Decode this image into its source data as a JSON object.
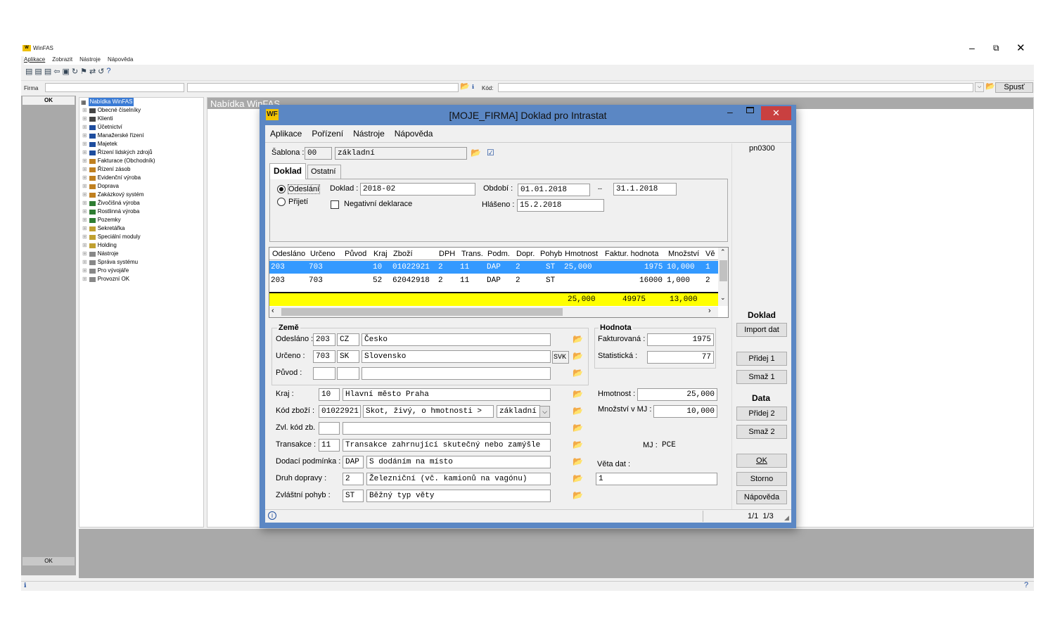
{
  "app": {
    "title": "WinFAS",
    "menu": [
      "Aplikace",
      "Zobrazit",
      "Nástroje",
      "Nápověda"
    ],
    "firma_label": "Firma",
    "kod_label": "Kód:",
    "spust_label": "Spusť",
    "left_ok": "OK",
    "left_ok_bottom": "OK",
    "panel_title": "Nabídka WinFAS",
    "tree_root": "Nabídka WinFAS",
    "tree": [
      {
        "label": "Obecné číselníky",
        "color": "#444"
      },
      {
        "label": "Klienti",
        "color": "#444"
      },
      {
        "label": "Účetnictví",
        "color": "#1e4d9e"
      },
      {
        "label": "Manažerské řízení",
        "color": "#1e4d9e"
      },
      {
        "label": "Majetek",
        "color": "#1e4d9e"
      },
      {
        "label": "Řízení lidských zdrojů",
        "color": "#1e4d9e"
      },
      {
        "label": "Fakturace (Obchodník)",
        "color": "#c08020"
      },
      {
        "label": "Řízení zásob",
        "color": "#c08020"
      },
      {
        "label": "Evidenční výroba",
        "color": "#c08020"
      },
      {
        "label": "Doprava",
        "color": "#c08020"
      },
      {
        "label": "Zakázkový systém",
        "color": "#c08020"
      },
      {
        "label": "Živočišná výroba",
        "color": "#2e7d32"
      },
      {
        "label": "Rostlinná výroba",
        "color": "#2e7d32"
      },
      {
        "label": "Pozemky",
        "color": "#2e7d32"
      },
      {
        "label": "Sekretářka",
        "color": "#c0a030"
      },
      {
        "label": "Speciální moduly",
        "color": "#c0a030"
      },
      {
        "label": "Holding",
        "color": "#c0a030"
      },
      {
        "label": "Nástroje",
        "color": "#888"
      },
      {
        "label": "Správa systému",
        "color": "#888"
      },
      {
        "label": "Pro vývojáře",
        "color": "#888"
      },
      {
        "label": "Provozní OK",
        "color": "#888"
      }
    ]
  },
  "dialog": {
    "logo": "WF",
    "title": "[MOJE_FIRMA] Doklad pro Intrastat",
    "menu": [
      "Aplikace",
      "Pořízení",
      "Nástroje",
      "Nápověda"
    ],
    "code": "pn0300",
    "sablona_label": "Šablona :",
    "sablona_code": "00",
    "sablona_name": "základní",
    "tabs": [
      "Doklad",
      "Ostatní"
    ],
    "odeslani_label": "Odeslání",
    "prijeti_label": "Přijetí",
    "doklad_label": "Doklad :",
    "doklad_value": "2018-02",
    "negativni_label": "Negativní deklarace",
    "obdobi_label": "Období :",
    "obdobi_from": "01.01.2018",
    "obdobi_dash": "--",
    "obdobi_to": "31.1.2018",
    "hlaseno_label": "Hlášeno :",
    "hlaseno_value": "15.2.2018",
    "grid_headers": [
      "Odesláno",
      "Určeno",
      "Původ",
      "Kraj",
      "Zboží",
      "DPH",
      "Trans.",
      "Podm.",
      "Dopr.",
      "Pohyb",
      "Hmotnost",
      "Faktur. hodnota",
      "Množství",
      "Vě"
    ],
    "grid_rows": [
      {
        "odeslano": "203",
        "urceno": "703",
        "puvod": "",
        "kraj": "10",
        "zbozi": "01022921",
        "dph": "2",
        "trans": "11",
        "podm": "DAP",
        "dopr": "2",
        "pohyb": "ST",
        "hmotnost": "25,000",
        "faktur": "1975",
        "mnozstvi": "10,000",
        "veta": "1"
      },
      {
        "odeslano": "203",
        "urceno": "703",
        "puvod": "",
        "kraj": "52",
        "zbozi": "62042918",
        "dph": "2",
        "trans": "11",
        "podm": "DAP",
        "dopr": "2",
        "pohyb": "ST",
        "hmotnost": "",
        "faktur": "16000",
        "mnozstvi": "1,000",
        "veta": "2"
      }
    ],
    "totals": {
      "hmotnost": "25,000",
      "faktur": "49975",
      "mnozstvi": "13,000"
    },
    "zeme_title": "Země",
    "odeslano_label": "Odesláno :",
    "odeslano_code": "203",
    "odeslano_iso": "CZ",
    "odeslano_name": "Česko",
    "urceno_label": "Určeno :",
    "urceno_code": "703",
    "urceno_iso": "SK",
    "urceno_name": "Slovensko",
    "svk_label": "SVK",
    "puvod_label": "Původ :",
    "hodnota_title": "Hodnota",
    "fakturovana_label": "Fakturovaná :",
    "fakturovana_value": "1975",
    "statisticka_label": "Statistická :",
    "statisticka_value": "77",
    "kraj_label": "Kraj :",
    "kraj_code": "10",
    "kraj_name": "Hlavní město Praha",
    "kod_zbozi_label": "Kód zboží :",
    "kod_zbozi_code": "01022921",
    "kod_zbozi_name": "Skot, živý, o hmotnosti >",
    "kod_zbozi_type": "základní",
    "zvl_kod_label": "Zvl. kód zb.",
    "transakce_label": "Transakce :",
    "transakce_code": "11",
    "transakce_name": "Transakce zahrnující skutečný nebo zamýšle",
    "dodaci_label": "Dodací podmínka :",
    "dodaci_code": "DAP",
    "dodaci_name": "S dodáním na místo",
    "druh_label": "Druh dopravy :",
    "druh_code": "2",
    "druh_name": "Železniční (vč. kamionů na vagónu)",
    "zvlastni_label": "Zvláštní pohyb :",
    "zvlastni_code": "ST",
    "zvlastni_name": "Běžný typ věty",
    "hmotnost_label": "Hmotnost :",
    "hmotnost_value": "25,000",
    "mnozstvi_label": "Množství v MJ :",
    "mnozstvi_value": "10,000",
    "mj_label": "MJ :",
    "mj_value": "PCE",
    "veta_label": "Věta dat :",
    "veta_value": "1",
    "side_doklad": "Doklad",
    "btn_import": "Import dat",
    "btn_pridej1": "Přidej 1",
    "btn_smaz1": "Smaž 1",
    "side_data": "Data",
    "btn_pridej2": "Přidej 2",
    "btn_smaz2": "Smaž 2",
    "btn_ok": "OK",
    "btn_storno": "Storno",
    "btn_napoveda": "Nápověda",
    "status_page": "1/1  1/3"
  }
}
